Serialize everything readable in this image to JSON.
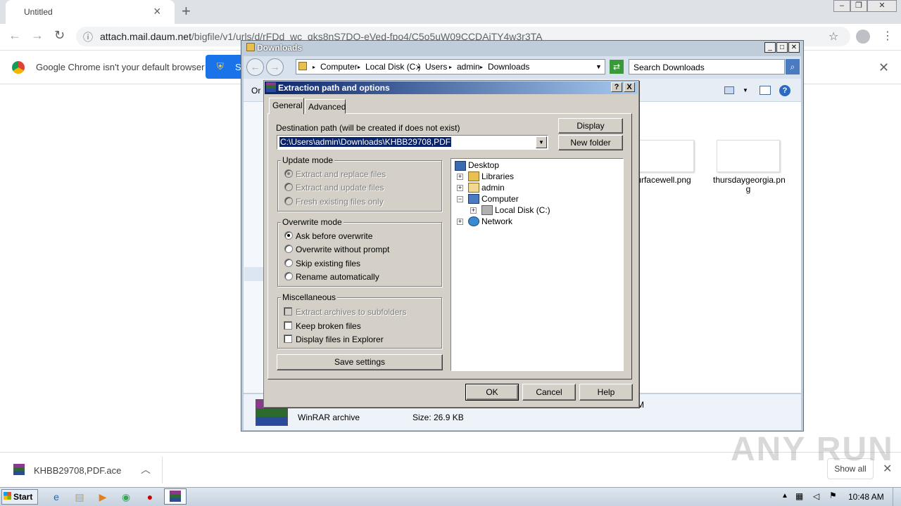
{
  "browser": {
    "tab_title": "Untitled",
    "url_host": "attach.mail.daum.net",
    "url_path": "/bigfile/v1/urls/d/rFDd_wc_qks8nS7DO-eVed-fpo4/C5o5uW09CCDAjTY4w3r3TA",
    "infobar_text": "Google Chrome isn't your default browser",
    "infobar_button_label": "S",
    "download_name": "KHBB29708,PDF.ace",
    "show_all_label": "Show all"
  },
  "explorer": {
    "title": "Downloads",
    "breadcrumb": [
      "Computer",
      "Local Disk (C:)",
      "Users",
      "admin",
      "Downloads"
    ],
    "search_placeholder": "Search Downloads",
    "organize_label": "Or",
    "files": [
      {
        "name": "urfacewell.png"
      },
      {
        "name": "thursdaygeorgia.pn g"
      }
    ],
    "details": {
      "type": "WinRAR archive",
      "size": "Size: 26.9 KB",
      "trail": "M"
    }
  },
  "dialog": {
    "title": "Extraction path and options",
    "help_btn": "?",
    "close_btn": "X",
    "tabs": [
      {
        "label": "General",
        "active": true
      },
      {
        "label": "Advanced",
        "active": false
      }
    ],
    "dest_label": "Destination path (will be created if does not exist)",
    "dest_value": "C:\\Users\\admin\\Downloads\\KHBB29708,PDF",
    "display_btn": "Display",
    "new_folder_btn": "New folder",
    "update_mode": {
      "title": "Update mode",
      "options": [
        {
          "label": "Extract and replace files",
          "checked": true,
          "disabled": true
        },
        {
          "label": "Extract and update files",
          "checked": false,
          "disabled": true
        },
        {
          "label": "Fresh existing files only",
          "checked": false,
          "disabled": true
        }
      ]
    },
    "overwrite_mode": {
      "title": "Overwrite mode",
      "options": [
        {
          "label": "Ask before overwrite",
          "checked": true
        },
        {
          "label": "Overwrite without prompt",
          "checked": false
        },
        {
          "label": "Skip existing files",
          "checked": false
        },
        {
          "label": "Rename automatically",
          "checked": false
        }
      ]
    },
    "misc": {
      "title": "Miscellaneous",
      "options": [
        {
          "label": "Extract archives to subfolders",
          "checked": false,
          "disabled": true
        },
        {
          "label": "Keep broken files",
          "checked": false
        },
        {
          "label": "Display files in Explorer",
          "checked": false
        }
      ]
    },
    "save_settings_btn": "Save settings",
    "tree": [
      {
        "label": "Desktop",
        "expander": ""
      },
      {
        "label": "Libraries",
        "expander": "+"
      },
      {
        "label": "admin",
        "expander": "+"
      },
      {
        "label": "Computer",
        "expander": "−"
      },
      {
        "label": "Local Disk (C:)",
        "expander": "+"
      },
      {
        "label": "Network",
        "expander": "+"
      }
    ],
    "ok_btn": "OK",
    "cancel_btn": "Cancel",
    "help_label": "Help"
  },
  "taskbar": {
    "start_label": "Start",
    "time": "10:48 AM"
  },
  "watermark": "ANY RUN"
}
